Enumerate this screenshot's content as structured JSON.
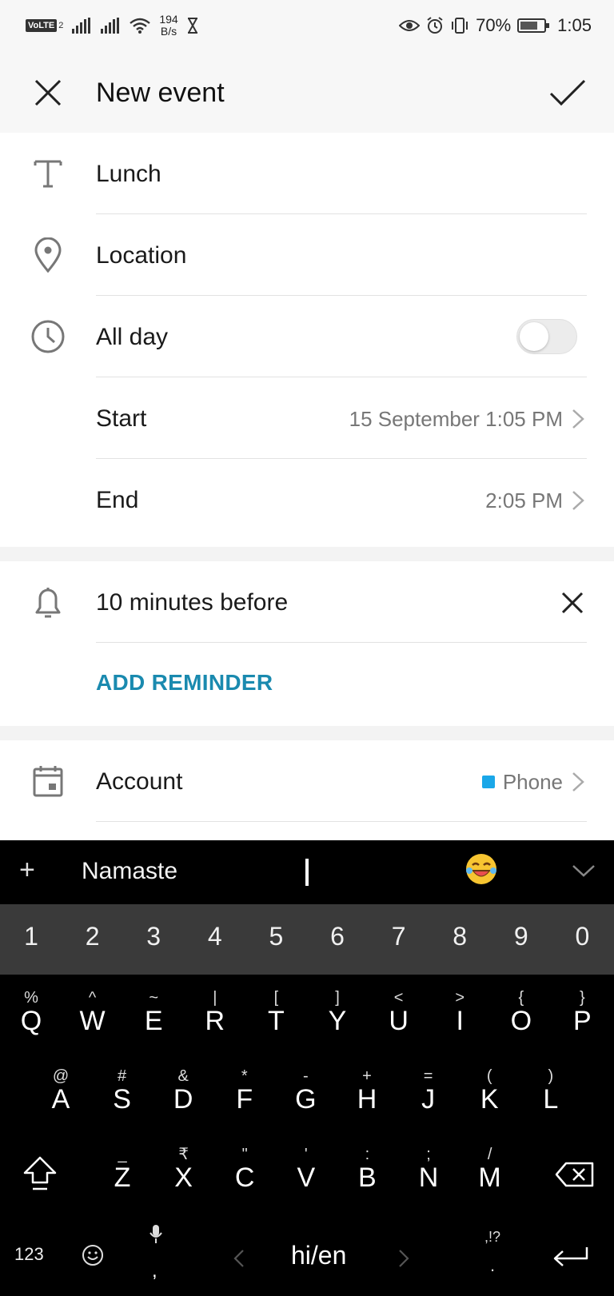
{
  "status_bar": {
    "volte": "VoLTE",
    "volte_sim": "2",
    "net_speed_value": "194",
    "net_speed_unit": "B/s",
    "battery": "70%",
    "time": "1:05"
  },
  "header": {
    "title": "New event"
  },
  "form": {
    "title_value": "Lunch",
    "location_placeholder": "Location",
    "all_day_label": "All day",
    "all_day_enabled": false,
    "start_label": "Start",
    "start_value": "15 September 1:05 PM",
    "end_label": "End",
    "end_value": "2:05 PM"
  },
  "reminders": {
    "items": [
      "10 minutes before"
    ],
    "add_label": "ADD REMINDER"
  },
  "account": {
    "label": "Account",
    "value": "Phone",
    "color": "#1aa7e8"
  },
  "keyboard": {
    "suggestions": [
      "Namaste",
      "I"
    ],
    "number_row": [
      "1",
      "2",
      "3",
      "4",
      "5",
      "6",
      "7",
      "8",
      "9",
      "0"
    ],
    "row1": [
      {
        "p": "Q",
        "s": "%"
      },
      {
        "p": "W",
        "s": "^"
      },
      {
        "p": "E",
        "s": "~"
      },
      {
        "p": "R",
        "s": "|"
      },
      {
        "p": "T",
        "s": "["
      },
      {
        "p": "Y",
        "s": "]"
      },
      {
        "p": "U",
        "s": "<"
      },
      {
        "p": "I",
        "s": ">"
      },
      {
        "p": "O",
        "s": "{"
      },
      {
        "p": "P",
        "s": "}"
      }
    ],
    "row2": [
      {
        "p": "A",
        "s": "@"
      },
      {
        "p": "S",
        "s": "#"
      },
      {
        "p": "D",
        "s": "&"
      },
      {
        "p": "F",
        "s": "*"
      },
      {
        "p": "G",
        "s": "-"
      },
      {
        "p": "H",
        "s": "+"
      },
      {
        "p": "J",
        "s": "="
      },
      {
        "p": "K",
        "s": "("
      },
      {
        "p": "L",
        "s": ")"
      }
    ],
    "row3": [
      {
        "p": "Z",
        "s": "_"
      },
      {
        "p": "X",
        "s": "₹"
      },
      {
        "p": "C",
        "s": "\""
      },
      {
        "p": "V",
        "s": "'"
      },
      {
        "p": "B",
        "s": ":"
      },
      {
        "p": "N",
        "s": ";"
      },
      {
        "p": "M",
        "s": "/"
      }
    ],
    "symbols_key": "123",
    "comma_key": ",",
    "language_key": "hi/en",
    "punct_key_top": ",!?",
    "punct_key_bottom": "."
  }
}
